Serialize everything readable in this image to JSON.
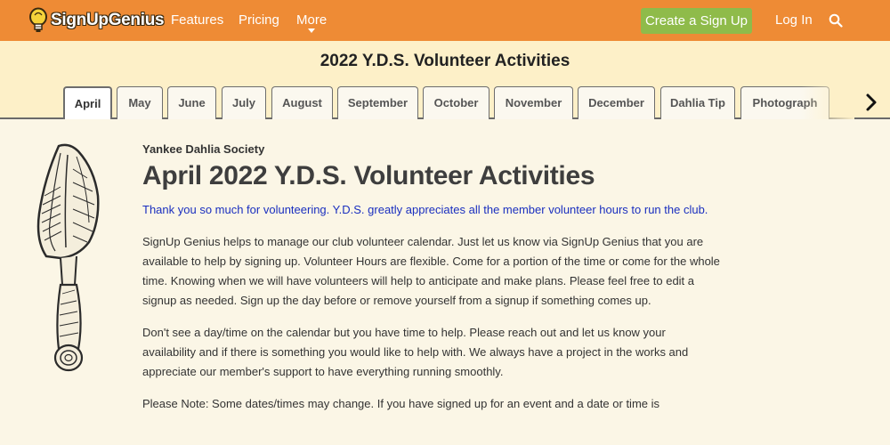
{
  "header": {
    "logo_text": "SignUpGenius",
    "nav": {
      "features": "Features",
      "pricing": "Pricing",
      "more": "More"
    },
    "create_button": "Create a Sign Up",
    "login": "Log In"
  },
  "page": {
    "title": "2022 Y.D.S. Volunteer Activities",
    "tabs": [
      {
        "label": "April",
        "active": true
      },
      {
        "label": "May"
      },
      {
        "label": "June"
      },
      {
        "label": "July"
      },
      {
        "label": "August"
      },
      {
        "label": "September"
      },
      {
        "label": "October"
      },
      {
        "label": "November"
      },
      {
        "label": "December"
      },
      {
        "label": "Dahlia Tip"
      },
      {
        "label": "Photograph"
      }
    ]
  },
  "content": {
    "organization": "Yankee Dahlia Society",
    "heading": "April 2022 Y.D.S. Volunteer Activities",
    "thanks": "Thank you so much for volunteering.  Y.D.S. greatly appreciates all the member volunteer hours to run the club.",
    "paragraph1": "SignUp Genius helps to manage our club volunteer calendar.  Just let us know via SignUp Genius that you are available to help by signing up.  Volunteer Hours are flexible.  Come for a portion of the time or come for the whole time.  Knowing when we will have volunteers will help to anticipate and make plans.  Please feel free to edit a signup as needed.  Sign up the day before or remove yourself from a signup if something comes up.",
    "paragraph2": "Don't see a day/time on the calendar but you have time to help.  Please reach out and let us know your availability and if there is something you would like to help with.  We always have a project in the works and appreciate our member's support to have everything running smoothly.",
    "paragraph3": "Please Note:  Some dates/times may change.  If you have signed up for an event and a date or time is"
  },
  "colors": {
    "topbar": "#ee8b35",
    "create_button": "#8fbb4a",
    "title_band": "#fdf0c8",
    "page_background": "#fbf6e6",
    "thanks_text": "#1a2fbf"
  },
  "icons": {
    "logo": "lightbulb-icon",
    "search": "search-icon",
    "next": "chevron-right-icon",
    "more": "caret-down-icon",
    "illustration": "trowel-illustration"
  }
}
